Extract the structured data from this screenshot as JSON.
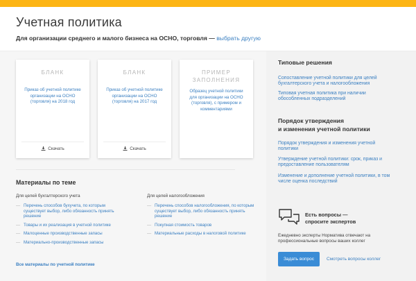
{
  "header": {
    "title": "Учетная политика",
    "subtitle": "Для организации среднего и малого бизнеса на ОСНО, торговля —",
    "choose_link": "выбрать другую"
  },
  "cards": [
    {
      "kind": "БЛАНК",
      "desc": "Приказ об учетной политике организации на ОСНО (торговля) на 2018 год",
      "download": "Скачать"
    },
    {
      "kind": "БЛАНК",
      "desc": "Приказ об учетной политике организации на ОСНО (торговля) на 2017 год",
      "download": "Скачать"
    },
    {
      "kind": "ПРИМЕР ЗАПОЛНЕНИЯ",
      "desc": "Образец учетной политики для организации на ОСНО (торговля), с примером и комментариями"
    }
  ],
  "materials": {
    "title": "Материалы по теме",
    "accounting": {
      "heading": "Для целей бухгалтерского учета",
      "items": [
        "Перечень способов бухучета, по которым существует выбор, либо обязанность принять решение",
        "Товары и их реализация в учетной политике",
        "Малоценные производственные запасы",
        "Материально-производственные запасы"
      ]
    },
    "tax": {
      "heading": "Для целей налогообложения",
      "items": [
        "Перечень способов налогообложения, по которым существует выбор, либо обязанность принять решение",
        "Покупная стоимость товаров",
        "Материальные расходы в налоговой политике"
      ]
    },
    "all_link": "Все материалы по учетной политике"
  },
  "sidebar": {
    "typical_heading": "Типовые решения",
    "typical_links": [
      "Сопоставление учетной политики для целей бухгалтерского учета и налогообложения",
      "Типовая учетная политика при наличии обособленных подразделений"
    ],
    "order_heading_1": "Порядок утверждения",
    "order_heading_2": "и изменения учетной политики",
    "order_links": [
      "Порядок утверждения и изменения учетной политики",
      "Утверждение учетной политики: срок, приказ и предоставление пользователям",
      "Изменение и дополнение учетной политики, в том числе оценка последствий"
    ],
    "questions_title_1": "Есть вопросы —",
    "questions_title_2": "спросите экспертов",
    "questions_text": "Ежедневно эксперты Норматива отвечают на профессиональные вопросы ваших коллег",
    "ask_button": "Задать вопрос",
    "see_link": "Смотреть вопросы коллег"
  },
  "colors": {
    "accent_bar": "#fdb515",
    "link": "#3a7fc1",
    "button": "#3a8cd6"
  }
}
